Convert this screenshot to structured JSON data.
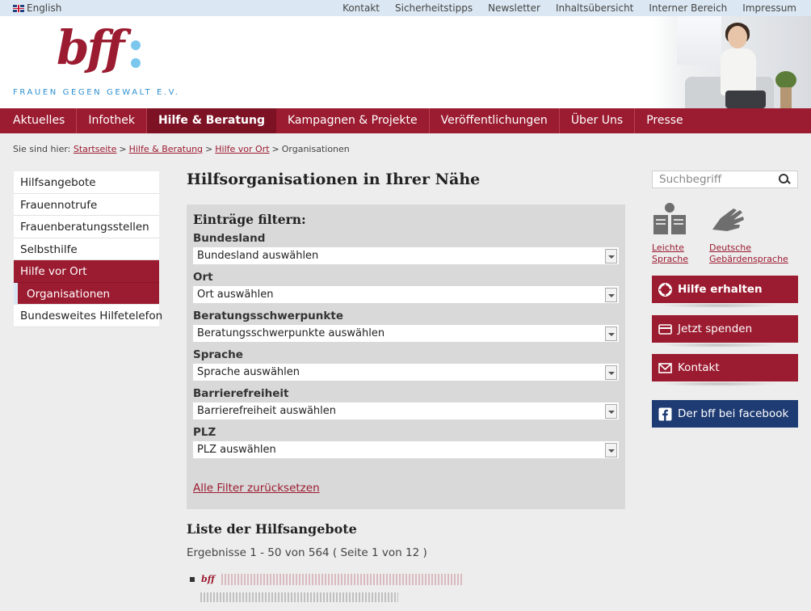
{
  "topbar": {
    "language": "English",
    "links": [
      "Kontakt",
      "Sicherheitstipps",
      "Newsletter",
      "Inhaltsübersicht",
      "Interner Bereich",
      "Impressum"
    ]
  },
  "header": {
    "logo_text": "bff",
    "tagline": "FRAUEN GEGEN GEWALT E.V."
  },
  "mainnav": {
    "items": [
      "Aktuelles",
      "Infothek",
      "Hilfe & Beratung",
      "Kampagnen & Projekte",
      "Veröffentlichungen",
      "Über Uns",
      "Presse"
    ],
    "active": "Hilfe & Beratung"
  },
  "breadcrumb": {
    "prefix": "Sie sind hier:",
    "items": [
      "Startseite",
      "Hilfe & Beratung",
      "Hilfe vor Ort"
    ],
    "current": "Organisationen"
  },
  "leftnav": {
    "items": [
      "Hilfsangebote",
      "Frauennotrufe",
      "Frauenberatungsstellen",
      "Selbsthilfe",
      "Hilfe vor Ort",
      "Organisationen",
      "Bundesweites Hilfetelefon"
    ]
  },
  "main": {
    "title": "Hilfsorganisationen in Ihrer Nähe",
    "filter": {
      "heading": "Einträge filtern:",
      "fields": [
        {
          "label": "Bundesland",
          "value": "Bundesland auswählen"
        },
        {
          "label": "Ort",
          "value": "Ort auswählen"
        },
        {
          "label": "Beratungsschwerpunkte",
          "value": "Beratungsschwerpunkte auswählen"
        },
        {
          "label": "Sprache",
          "value": "Sprache auswählen"
        },
        {
          "label": "Barrierefreiheit",
          "value": "Barrierefreiheit auswählen"
        },
        {
          "label": "PLZ",
          "value": "PLZ auswählen"
        }
      ],
      "reset": "Alle Filter zurücksetzen"
    },
    "list_title": "Liste der Hilfsangebote",
    "results": "Ergebnisse 1 - 50 von 564 ( Seite 1 von 12 )",
    "entry_logo": "bff"
  },
  "sidebar": {
    "search_placeholder": "Suchbegriff",
    "easy_language": [
      "Leichte",
      "Sprache"
    ],
    "sign_language": [
      "Deutsche",
      "Gebärdensprache"
    ],
    "buttons": {
      "help": "Hilfe erhalten",
      "donate": "Jetzt spenden",
      "contact": "Kontakt",
      "facebook": "Der bff bei facebook"
    }
  },
  "colors": {
    "brand": "#9b1b30",
    "brand_dark": "#7d1225",
    "accent_blue": "#2e8fcf",
    "facebook": "#1e3b73"
  }
}
